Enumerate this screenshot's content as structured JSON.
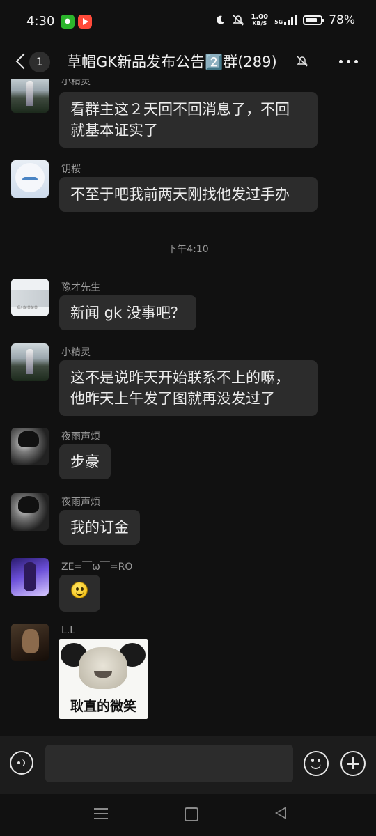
{
  "status_bar": {
    "time": "4:30",
    "net_speed_value": "1.00",
    "net_speed_unit": "KB/S",
    "network_type": "5G",
    "battery": "78%",
    "battery_level": 0.78,
    "icons": [
      "app-icon",
      "video-icon",
      "night-mode-icon",
      "mute-icon",
      "wifi-icon",
      "signal-icon",
      "battery-icon"
    ]
  },
  "header": {
    "back_badge": "1",
    "title": "草帽GK新品发布公告2️⃣群(289)",
    "icons": [
      "back-icon",
      "mute-bell-icon",
      "more-icon"
    ]
  },
  "messages": [
    {
      "sender": "小精灵",
      "text_lines": [
        "看群主这２天回不回消息了，不回",
        "就基本证实了"
      ],
      "avatar": "fountain"
    },
    {
      "sender": "钥桜",
      "text_lines": [
        "不至于吧我前两天刚找他发过手办"
      ],
      "avatar": "anime-girl"
    },
    {
      "timestamp": "下午4:10"
    },
    {
      "sender": "豫才先生",
      "text_lines": [
        "新闻 gk 没事吧？"
      ],
      "avatar": "card"
    },
    {
      "sender": "小精灵",
      "text_lines": [
        "这不是说昨天开始联系不上的嘛，",
        "他昨天上午发了图就再没发过了"
      ],
      "avatar": "fountain"
    },
    {
      "sender": "夜雨声烦",
      "text_lines": [
        "步豪"
      ],
      "avatar": "dark-character"
    },
    {
      "sender": "夜雨声烦",
      "text_lines": [
        "我的订金"
      ],
      "avatar": "dark-character"
    },
    {
      "sender": "ZE=￣ω￣=RO",
      "emoji": "smile-emoji",
      "avatar": "purple-character"
    },
    {
      "sender": "L.L",
      "sticker_caption": "耿直的微笑",
      "avatar": "ll-character"
    }
  ],
  "input_bar": {
    "placeholder": "",
    "icons": [
      "voice-icon",
      "emoji-icon",
      "plus-icon"
    ]
  },
  "nav_bar": {
    "icons": [
      "menu-icon",
      "home-icon",
      "back-nav-icon"
    ]
  },
  "colors": {
    "background": "#111111",
    "bubble": "#2c2c2c",
    "input_bar": "#1c1c1c",
    "text": "#ececec",
    "muted_text": "#9a9a9a"
  }
}
